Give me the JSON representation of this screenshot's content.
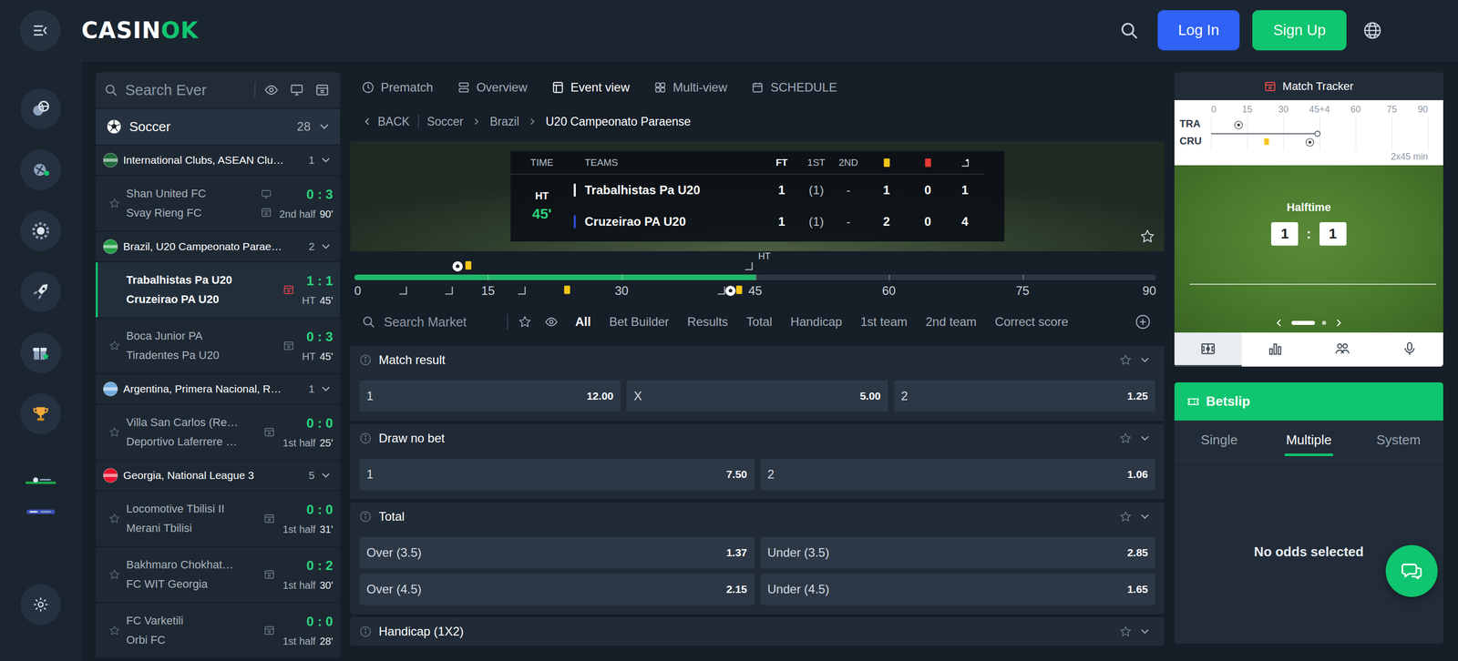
{
  "header": {
    "logo": {
      "main": "CASIN",
      "accent": "OK"
    },
    "login": "Log In",
    "signup": "Sign Up"
  },
  "sidebar": {
    "search_placeholder": "Search Ever",
    "sport": {
      "name": "Soccer",
      "count": "28",
      "expanded": true
    },
    "leagues": [
      {
        "name": "International Clubs, ASEAN Clu…",
        "count": "1",
        "expanded": true,
        "color": "#1e6b3c",
        "events": [
          {
            "home": "Shan United FC",
            "away": "Svay Rieng FC",
            "score": "0 : 3",
            "period": "2nd half",
            "minute": "90'",
            "selected": false,
            "stream": true
          }
        ]
      },
      {
        "name": "Brazil, U20 Campeonato Parae…",
        "count": "2",
        "expanded": true,
        "color": "#229e45",
        "events": [
          {
            "home": "Trabalhistas Pa U20",
            "away": "Cruzeirao PA U20",
            "score": "1 : 1",
            "period": "HT",
            "minute": "45'",
            "selected": true,
            "stream": false
          },
          {
            "home": "Boca Junior PA",
            "away": "Tiradentes Pa U20",
            "score": "0 : 3",
            "period": "HT",
            "minute": "45'",
            "selected": false,
            "stream": false
          }
        ]
      },
      {
        "name": "Argentina, Primera Nacional, R…",
        "count": "1",
        "expanded": true,
        "color": "#74acdf",
        "events": [
          {
            "home": "Villa San Carlos (Re…",
            "away": "Deportivo Laferrere …",
            "score": "0 : 0",
            "period": "1st half",
            "minute": "25'",
            "selected": false,
            "stream": false
          }
        ]
      },
      {
        "name": "Georgia, National League 3",
        "count": "5",
        "expanded": true,
        "color": "#e8112d",
        "events": [
          {
            "home": "Locomotive Tbilisi II",
            "away": "Merani Tbilisi",
            "score": "0 : 0",
            "period": "1st half",
            "minute": "31'",
            "selected": false,
            "stream": false
          },
          {
            "home": "Bakhmaro Chokhat…",
            "away": "FC WIT Georgia",
            "score": "0 : 2",
            "period": "1st half",
            "minute": "30'",
            "selected": false,
            "stream": false
          },
          {
            "home": "FC Varketili",
            "away": "Orbi FC",
            "score": "0 : 0",
            "period": "1st half",
            "minute": "28'",
            "selected": false,
            "stream": false
          }
        ]
      }
    ]
  },
  "event_view": {
    "tabs": [
      {
        "label": "Prematch",
        "selected": false,
        "kind": "clock"
      },
      {
        "label": "Overview",
        "selected": false,
        "kind": "overview"
      },
      {
        "label": "Event view",
        "selected": true,
        "kind": "event"
      },
      {
        "label": "Multi-view",
        "selected": false,
        "kind": "multi"
      },
      {
        "label": "SCHEDULE",
        "selected": false,
        "kind": "calendar"
      }
    ],
    "breadcrumb": {
      "back": "BACK",
      "items": [
        "Soccer",
        "Brazil",
        "U20 Campeonato Paraense"
      ]
    },
    "scoreboard": {
      "headers": {
        "time": "TIME",
        "teams": "TEAMS",
        "ft": "FT",
        "first": "1ST",
        "second": "2ND"
      },
      "period": "HT",
      "minute": "45'",
      "teams": [
        {
          "name": "Trabalhistas Pa U20",
          "color": "#ffffff",
          "ft": "1",
          "first": "(1)",
          "second": "-",
          "yellow": "1",
          "red": "0",
          "corners": "1"
        },
        {
          "name": "Cruzeirao PA U20",
          "color": "#2f4bd6",
          "ft": "1",
          "first": "(1)",
          "second": "-",
          "yellow": "2",
          "red": "0",
          "corners": "4"
        }
      ]
    },
    "timeline": {
      "level": 0.5,
      "half_label": "HT",
      "half_at": 45,
      "ticks": [
        "0",
        "15",
        "30",
        "45",
        "60",
        "75",
        "90"
      ],
      "events": [
        {
          "minute": 11.6,
          "side": "top",
          "kind": "goal"
        },
        {
          "minute": 12.8,
          "side": "top",
          "kind": "yellow"
        },
        {
          "minute": 44.3,
          "side": "top",
          "kind": "corner"
        },
        {
          "minute": 5.5,
          "side": "bottom",
          "kind": "corner"
        },
        {
          "minute": 10.6,
          "side": "bottom",
          "kind": "corner"
        },
        {
          "minute": 18.8,
          "side": "bottom",
          "kind": "corner"
        },
        {
          "minute": 23.9,
          "side": "bottom",
          "kind": "yellow"
        },
        {
          "minute": 41.2,
          "side": "bottom",
          "kind": "corner"
        },
        {
          "minute": 42.2,
          "side": "bottom",
          "kind": "goal"
        },
        {
          "minute": 43.2,
          "side": "bottom",
          "kind": "yellow"
        }
      ]
    }
  },
  "market_filter": {
    "placeholder": "Search Market",
    "tabs": [
      {
        "label": "All",
        "selected": true
      },
      {
        "label": "Bet Builder",
        "selected": false
      },
      {
        "label": "Results",
        "selected": false
      },
      {
        "label": "Total",
        "selected": false
      },
      {
        "label": "Handicap",
        "selected": false
      },
      {
        "label": "1st team",
        "selected": false
      },
      {
        "label": "2nd team",
        "selected": false
      },
      {
        "label": "Correct score",
        "selected": false
      }
    ]
  },
  "markets": [
    {
      "title": "Match result",
      "expanded": true,
      "rows": [
        [
          {
            "label": "1",
            "odds": "12.00"
          },
          {
            "label": "X",
            "odds": "5.00"
          },
          {
            "label": "2",
            "odds": "1.25"
          }
        ]
      ]
    },
    {
      "title": "Draw no bet",
      "expanded": true,
      "rows": [
        [
          {
            "label": "1",
            "odds": "7.50"
          },
          {
            "label": "2",
            "odds": "1.06"
          }
        ]
      ]
    },
    {
      "title": "Total",
      "expanded": true,
      "rows": [
        [
          {
            "label": "Over (3.5)",
            "odds": "1.37"
          },
          {
            "label": "Under (3.5)",
            "odds": "2.85"
          }
        ],
        [
          {
            "label": "Over (4.5)",
            "odds": "2.15"
          },
          {
            "label": "Under (4.5)",
            "odds": "1.65"
          }
        ]
      ]
    },
    {
      "title": "Handicap (1X2)",
      "expanded": true,
      "rows": []
    }
  ],
  "tracker": {
    "title": "Match Tracker",
    "ticks": [
      "0",
      "15",
      "30",
      "45+4",
      "60",
      "75",
      "90"
    ],
    "level": 0.49,
    "format": "2x45 min",
    "teams": [
      {
        "code": "TRA",
        "events": [
          {
            "minute": 11.5,
            "kind": "goal"
          }
        ]
      },
      {
        "code": "CRU",
        "events": [
          {
            "minute": 23,
            "kind": "yellow"
          },
          {
            "minute": 41,
            "kind": "goal"
          }
        ]
      }
    ],
    "status": "Halftime",
    "score": {
      "home": "1",
      "separator": ":",
      "away": "1"
    },
    "pages": [
      {
        "selected": true
      },
      {
        "selected": false
      }
    ],
    "tabs": [
      {
        "kind": "pitch",
        "selected": true
      },
      {
        "kind": "stats",
        "selected": false
      },
      {
        "kind": "lineups",
        "selected": false
      },
      {
        "kind": "commentary",
        "selected": false
      }
    ]
  },
  "betslip": {
    "title": "Betslip",
    "tabs": [
      {
        "label": "Single",
        "selected": false
      },
      {
        "label": "Multiple",
        "selected": true
      },
      {
        "label": "System",
        "selected": false
      }
    ],
    "empty": "No odds selected"
  }
}
